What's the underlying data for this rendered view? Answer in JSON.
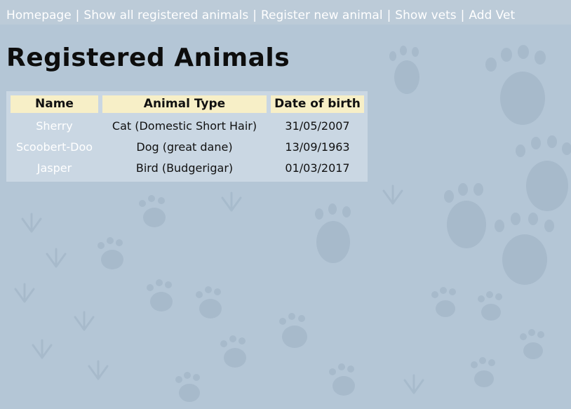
{
  "nav": {
    "items": [
      {
        "label": "Homepage"
      },
      {
        "label": "Show all registered animals"
      },
      {
        "label": "Register new animal"
      },
      {
        "label": "Show vets"
      },
      {
        "label": "Add Vet"
      }
    ],
    "separator": "|"
  },
  "page": {
    "title": "Registered Animals"
  },
  "table": {
    "columns": [
      "Name",
      "Animal Type",
      "Date of birth"
    ],
    "rows": [
      {
        "name": "Sherry",
        "type": "Cat (Domestic Short Hair)",
        "dob": "31/05/2007"
      },
      {
        "name": "Scoobert-Doo",
        "type": "Dog (great dane)",
        "dob": "13/09/1963"
      },
      {
        "name": "Jasper",
        "type": "Bird (Budgerigar)",
        "dob": "01/03/2017"
      }
    ]
  },
  "colors": {
    "background": "#b4c6d6",
    "paw_print": "#a3b7c9",
    "header_cell": "#f7efc7",
    "nav_text": "#ffffff",
    "name_text": "#ffffff"
  }
}
